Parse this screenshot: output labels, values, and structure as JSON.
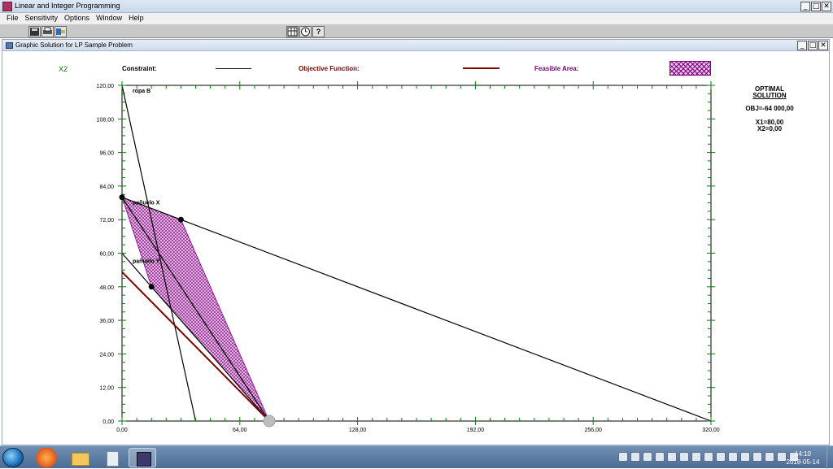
{
  "app": {
    "title": "Linear and Integer Programming",
    "minimize": "_",
    "maximize": "□",
    "close": "✕"
  },
  "menu": [
    "File",
    "Sensitivity",
    "Options",
    "Window",
    "Help"
  ],
  "toolbar": {
    "left_icons": [
      "save-icon",
      "print-icon",
      "export-icon"
    ],
    "right_icons": [
      "table-icon",
      "clock-icon",
      "help-icon"
    ],
    "help_glyph": "?"
  },
  "window": {
    "title": "Graphic Solution for LP Sample Problem"
  },
  "legend": {
    "y_axis_var": "X2",
    "constraint_label": "Constraint:",
    "objective_label": "Objective Function:",
    "feasible_label": "Feasible Area:",
    "constraint_color": "#000000",
    "objective_color": "#800000",
    "feasible_color": "#800080"
  },
  "solution": {
    "title_line1": "OPTIMAL",
    "title_line2": "SOLUTION",
    "obj": "OBJ=-64 000,00",
    "x1": "X1=80,00",
    "x2": "X2=0,00"
  },
  "chart_data": {
    "type": "line",
    "xlim": [
      0,
      320
    ],
    "ylim": [
      0,
      120
    ],
    "x_ticks": [
      "0,00",
      "64,00",
      "128,00",
      "192,00",
      "256,00",
      "320,00"
    ],
    "x_tick_values": [
      0,
      64,
      128,
      192,
      256,
      320
    ],
    "y_ticks": [
      "0,00",
      "12,00",
      "24,00",
      "36,00",
      "48,00",
      "60,00",
      "72,00",
      "84,00",
      "96,00",
      "108,00",
      "120,00"
    ],
    "y_tick_values": [
      0,
      12,
      24,
      36,
      48,
      60,
      72,
      84,
      96,
      108,
      120
    ],
    "constraints": [
      {
        "label": "ropa B",
        "points": [
          [
            0,
            120
          ],
          [
            40,
            0
          ]
        ]
      },
      {
        "label": "pañuelo X",
        "points": [
          [
            0,
            80
          ],
          [
            320,
            0
          ]
        ]
      },
      {
        "label": "pañuelo Y",
        "points": [
          [
            0,
            60
          ],
          [
            80,
            0
          ]
        ]
      },
      {
        "label": "",
        "points": [
          [
            0,
            80
          ],
          [
            80,
            0
          ]
        ]
      }
    ],
    "objective": {
      "points": [
        [
          0,
          53.3
        ],
        [
          80,
          0
        ]
      ]
    },
    "feasible_region": [
      [
        0,
        80
      ],
      [
        32,
        72
      ],
      [
        80,
        0
      ],
      [
        16,
        48
      ]
    ],
    "vertices": [
      [
        0,
        80
      ],
      [
        32,
        72
      ],
      [
        16,
        48
      ]
    ],
    "optimum": [
      80,
      0
    ],
    "grid": false
  },
  "taskbar": {
    "apps": [
      "start-button",
      "firefox",
      "file-explorer",
      "document",
      "lp-program"
    ],
    "time": "14:10",
    "date": "2018-05-14"
  }
}
